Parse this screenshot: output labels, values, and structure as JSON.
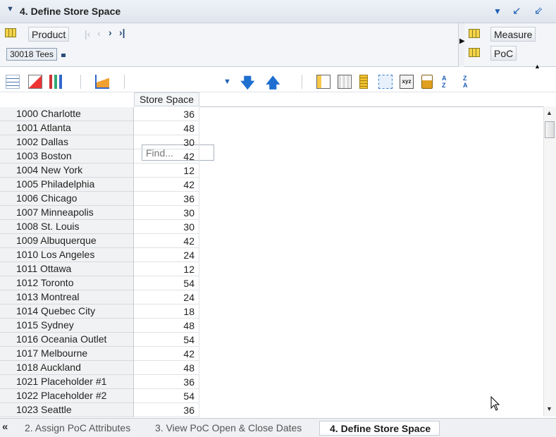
{
  "titlebar": {
    "title": "4. Define Store Space"
  },
  "pov": {
    "product_label": "Product",
    "product_value": "30018 Tees",
    "measure_label": "Measure",
    "poc_label": "PoC"
  },
  "toolbar": {
    "find_placeholder": "Find..."
  },
  "grid": {
    "column_header": "Store Space",
    "rows": [
      {
        "store": "1000 Charlotte",
        "value": "36"
      },
      {
        "store": "1001 Atlanta",
        "value": "48"
      },
      {
        "store": "1002 Dallas",
        "value": "30"
      },
      {
        "store": "1003 Boston",
        "value": "42"
      },
      {
        "store": "1004 New York",
        "value": "12"
      },
      {
        "store": "1005 Philadelphia",
        "value": "42"
      },
      {
        "store": "1006 Chicago",
        "value": "36"
      },
      {
        "store": "1007 Minneapolis",
        "value": "30"
      },
      {
        "store": "1008 St. Louis",
        "value": "30"
      },
      {
        "store": "1009 Albuquerque",
        "value": "42"
      },
      {
        "store": "1010 Los Angeles",
        "value": "24"
      },
      {
        "store": "1011 Ottawa",
        "value": "12"
      },
      {
        "store": "1012 Toronto",
        "value": "54"
      },
      {
        "store": "1013 Montreal",
        "value": "24"
      },
      {
        "store": "1014 Quebec City",
        "value": "18"
      },
      {
        "store": "1015 Sydney",
        "value": "48"
      },
      {
        "store": "1016 Oceania Outlet",
        "value": "54"
      },
      {
        "store": "1017 Melbourne",
        "value": "42"
      },
      {
        "store": "1018 Auckland",
        "value": "48"
      },
      {
        "store": "1021 Placeholder #1",
        "value": "36"
      },
      {
        "store": "1022 Placeholder #2",
        "value": "54"
      },
      {
        "store": "1023 Seattle",
        "value": "36"
      }
    ]
  },
  "tabs": [
    {
      "label": "2. Assign PoC Attributes"
    },
    {
      "label": "3. View PoC Open & Close Dates"
    },
    {
      "label": "4. Define Store Space"
    }
  ],
  "colors": {
    "accent": "#1f5fb4",
    "title_bg": "#e4e9f0"
  }
}
